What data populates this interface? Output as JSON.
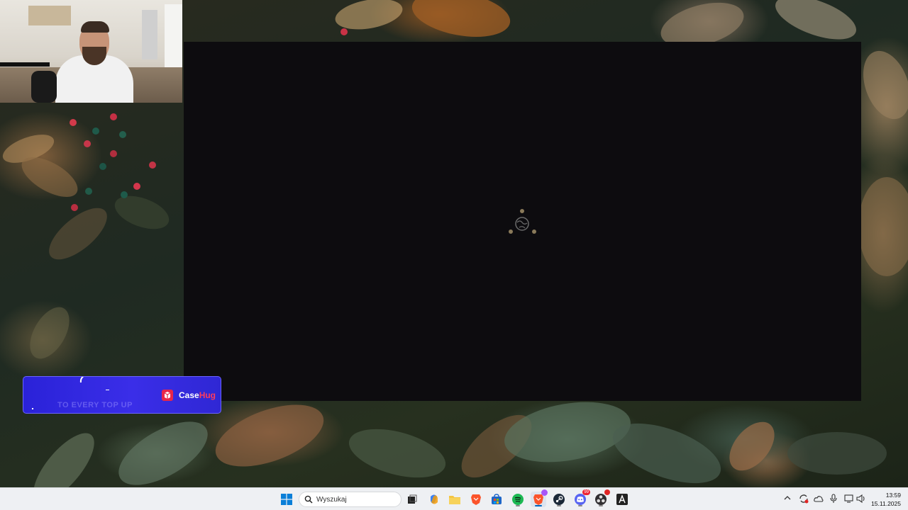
{
  "desktop": {
    "wallpaper": "leaves-and-berries"
  },
  "webcam": {
    "description_icon": "streamer-webcam"
  },
  "app_window": {
    "state": "loading",
    "loader_icon": "globe-spinner-icon",
    "background": "#0d0c0f"
  },
  "promo_banner": {
    "brand_prefix": "Case",
    "brand_suffix": "Hug",
    "faint_text": "TO EVERY TOP UP",
    "colors": {
      "background": "#3a2ee8",
      "accent": "#ff3b5c"
    }
  },
  "taskbar": {
    "search_placeholder": "Wyszukaj",
    "pinned": [
      {
        "name": "start-button",
        "icon": "windows-logo-icon"
      },
      {
        "name": "task-view-button",
        "icon": "task-view-icon"
      },
      {
        "name": "copilot-button",
        "icon": "copilot-icon"
      },
      {
        "name": "file-explorer-button",
        "icon": "folder-icon"
      },
      {
        "name": "brave-button",
        "icon": "brave-lion-icon"
      },
      {
        "name": "store-button",
        "icon": "store-icon"
      },
      {
        "name": "spotify-button",
        "icon": "spotify-icon"
      },
      {
        "name": "brave-active-button",
        "icon": "brave-lion-icon"
      },
      {
        "name": "steam-button",
        "icon": "steam-icon"
      },
      {
        "name": "discord-button",
        "icon": "discord-icon"
      },
      {
        "name": "obs-button",
        "icon": "obs-icon"
      },
      {
        "name": "app-a-button",
        "icon": "app-a-icon"
      }
    ],
    "discord_badge": "99",
    "clock": {
      "time": "13:59",
      "date": "15.11.2025"
    }
  }
}
